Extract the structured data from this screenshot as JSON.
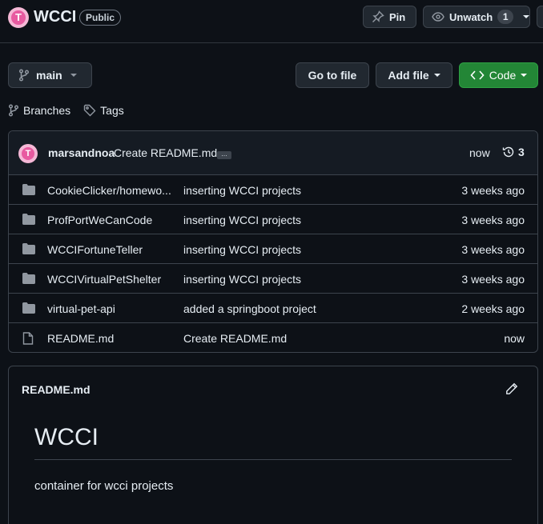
{
  "repo": {
    "avatar_letter": "T",
    "name": "WCCI",
    "visibility": "Public"
  },
  "header_actions": {
    "pin_label": "Pin",
    "unwatch_label": "Unwatch",
    "watch_count": "1"
  },
  "toolbar": {
    "branch": "main",
    "goto_label": "Go to file",
    "addfile_label": "Add file",
    "code_label": "Code"
  },
  "meta": {
    "branches_label": "Branches",
    "tags_label": "Tags"
  },
  "latest_commit": {
    "avatar_letter": "T",
    "author": "marsandnoa",
    "message": "Create README.md",
    "ellipsis": "...",
    "time": "now",
    "history_count": "3"
  },
  "files": [
    {
      "type": "folder",
      "name": "CookieClicker/homewo...",
      "commit": "inserting WCCI projects",
      "age": "3 weeks ago"
    },
    {
      "type": "folder",
      "name": "ProfPortWeCanCode",
      "commit": "inserting WCCI projects",
      "age": "3 weeks ago"
    },
    {
      "type": "folder",
      "name": "WCCIFortuneTeller",
      "commit": "inserting WCCI projects",
      "age": "3 weeks ago"
    },
    {
      "type": "folder",
      "name": "WCCIVirtualPetShelter",
      "commit": "inserting WCCI projects",
      "age": "3 weeks ago"
    },
    {
      "type": "folder",
      "name": "virtual-pet-api",
      "commit": "added a springboot project",
      "age": "2 weeks ago"
    },
    {
      "type": "file",
      "name": "README.md",
      "commit": "Create README.md",
      "age": "now"
    }
  ],
  "readme": {
    "title": "README.md",
    "heading": "WCCI",
    "body": "container for wcci projects"
  },
  "colors": {
    "background": "#0d1117",
    "border": "#3d444d",
    "code_button": "#238636",
    "avatar": "#e85aa0"
  }
}
